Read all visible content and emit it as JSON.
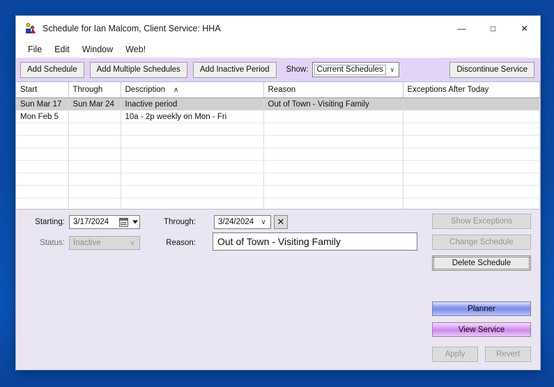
{
  "window": {
    "title": "Schedule for Ian Malcom, Client Service: HHA",
    "icon": "people-icon",
    "controls": {
      "minimize": "—",
      "maximize": "□",
      "close": "✕"
    }
  },
  "menu": {
    "items": [
      {
        "label": "File"
      },
      {
        "label": "Edit"
      },
      {
        "label": "Window"
      },
      {
        "label": "Web!"
      }
    ]
  },
  "toolbar": {
    "add_schedule": "Add Schedule",
    "add_multiple_schedules": "Add Multiple Schedules",
    "add_inactive_period": "Add Inactive Period",
    "show_label": "Show:",
    "show_value": "Current Schedules",
    "show_arrow": "∨",
    "discontinue_service": "Discontinue Service"
  },
  "grid": {
    "columns": [
      {
        "label": "Start",
        "sort": ""
      },
      {
        "label": "Through",
        "sort": ""
      },
      {
        "label": "Description",
        "sort": "∧"
      },
      {
        "label": "Reason",
        "sort": ""
      },
      {
        "label": "Exceptions After Today",
        "sort": ""
      }
    ],
    "rows": [
      {
        "selected": true,
        "cells": [
          "Sun Mar 17",
          "Sun Mar 24",
          "Inactive period",
          "Out of Town - Visiting Family",
          ""
        ]
      },
      {
        "selected": false,
        "cells": [
          "Mon Feb 5",
          "",
          "10a - 2p weekly on Mon - Fri",
          "",
          ""
        ]
      }
    ],
    "empty_row_count": 8
  },
  "form": {
    "starting_label": "Starting:",
    "starting_value": "3/17/2024",
    "status_label": "Status:",
    "status_value": "Inactive",
    "status_chevron": "∨",
    "through_label": "Through:",
    "through_value": "3/24/2024",
    "through_chevron": "∨",
    "clear_through": "✕",
    "reason_label": "Reason:",
    "reason_value": "Out of Town - Visiting Family"
  },
  "actions": {
    "show_exceptions": "Show Exceptions",
    "change_schedule": "Change Schedule",
    "delete_schedule": "Delete Schedule",
    "planner": "Planner",
    "view_service": "View Service",
    "apply": "Apply",
    "revert": "Revert"
  },
  "colors": {
    "desktop": "#0b4aa2",
    "toolbar_bg": "#e3d4f5",
    "panel_bg": "#eae5f2",
    "selected_row": "#d0d0d0",
    "planner_accent": "#8d9bf0",
    "view_service_accent": "#d99bf2"
  }
}
